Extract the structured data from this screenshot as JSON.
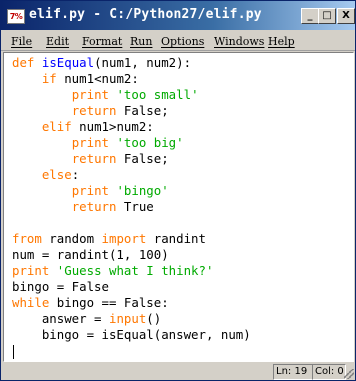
{
  "window": {
    "title": "elif.py - C:/Python27/elif.py",
    "icon_text": "7%",
    "buttons": {
      "minimize": "_",
      "maximize": "□",
      "close": "X"
    }
  },
  "menu": {
    "items": [
      {
        "label": "File"
      },
      {
        "label": "Edit"
      },
      {
        "label": "Format"
      },
      {
        "label": "Run"
      },
      {
        "label": "Options"
      },
      {
        "label": "Windows"
      },
      {
        "label": "Help"
      }
    ]
  },
  "editor": {
    "lines": [
      [
        {
          "t": "def",
          "c": "kw"
        },
        {
          "t": " "
        },
        {
          "t": "isEqual",
          "c": "fn"
        },
        {
          "t": "(num1, num2):"
        }
      ],
      [
        {
          "t": "    "
        },
        {
          "t": "if",
          "c": "kw"
        },
        {
          "t": " num1<num2:"
        }
      ],
      [
        {
          "t": "        "
        },
        {
          "t": "print",
          "c": "kw"
        },
        {
          "t": " "
        },
        {
          "t": "'too small'",
          "c": "str"
        }
      ],
      [
        {
          "t": "        "
        },
        {
          "t": "return",
          "c": "kw"
        },
        {
          "t": " False;"
        }
      ],
      [
        {
          "t": "    "
        },
        {
          "t": "elif",
          "c": "kw"
        },
        {
          "t": " num1>num2:"
        }
      ],
      [
        {
          "t": "        "
        },
        {
          "t": "print",
          "c": "kw"
        },
        {
          "t": " "
        },
        {
          "t": "'too big'",
          "c": "str"
        }
      ],
      [
        {
          "t": "        "
        },
        {
          "t": "return",
          "c": "kw"
        },
        {
          "t": " False;"
        }
      ],
      [
        {
          "t": "    "
        },
        {
          "t": "else",
          "c": "kw"
        },
        {
          "t": ":"
        }
      ],
      [
        {
          "t": "        "
        },
        {
          "t": "print",
          "c": "kw"
        },
        {
          "t": " "
        },
        {
          "t": "'bingo'",
          "c": "str"
        }
      ],
      [
        {
          "t": "        "
        },
        {
          "t": "return",
          "c": "kw"
        },
        {
          "t": " True"
        }
      ],
      [
        {
          "t": ""
        }
      ],
      [
        {
          "t": "from",
          "c": "kw"
        },
        {
          "t": " random "
        },
        {
          "t": "import",
          "c": "kw"
        },
        {
          "t": " randint"
        }
      ],
      [
        {
          "t": "num = randint(1, 100)"
        }
      ],
      [
        {
          "t": "print",
          "c": "kw"
        },
        {
          "t": " "
        },
        {
          "t": "'Guess what I think?'",
          "c": "str"
        }
      ],
      [
        {
          "t": "bingo = False"
        }
      ],
      [
        {
          "t": "while",
          "c": "kw"
        },
        {
          "t": " bingo == False:"
        }
      ],
      [
        {
          "t": "    answer = "
        },
        {
          "t": "input",
          "c": "kw"
        },
        {
          "t": "()"
        }
      ],
      [
        {
          "t": "    bingo = isEqual(answer, num)"
        }
      ],
      [
        {
          "t": ""
        }
      ]
    ]
  },
  "status": {
    "line": "Ln: 19",
    "col": "Col: 0"
  },
  "colors": {
    "keyword": "#ff7700",
    "string": "#00aa00",
    "function_name": "#0000ff"
  }
}
